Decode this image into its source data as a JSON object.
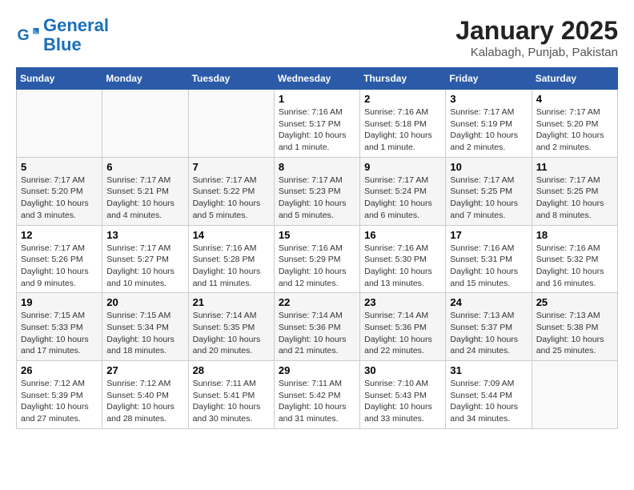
{
  "header": {
    "logo_line1": "General",
    "logo_line2": "Blue",
    "month": "January 2025",
    "location": "Kalabagh, Punjab, Pakistan"
  },
  "days_of_week": [
    "Sunday",
    "Monday",
    "Tuesday",
    "Wednesday",
    "Thursday",
    "Friday",
    "Saturday"
  ],
  "weeks": [
    [
      {
        "day": "",
        "info": ""
      },
      {
        "day": "",
        "info": ""
      },
      {
        "day": "",
        "info": ""
      },
      {
        "day": "1",
        "info": "Sunrise: 7:16 AM\nSunset: 5:17 PM\nDaylight: 10 hours\nand 1 minute."
      },
      {
        "day": "2",
        "info": "Sunrise: 7:16 AM\nSunset: 5:18 PM\nDaylight: 10 hours\nand 1 minute."
      },
      {
        "day": "3",
        "info": "Sunrise: 7:17 AM\nSunset: 5:19 PM\nDaylight: 10 hours\nand 2 minutes."
      },
      {
        "day": "4",
        "info": "Sunrise: 7:17 AM\nSunset: 5:20 PM\nDaylight: 10 hours\nand 2 minutes."
      }
    ],
    [
      {
        "day": "5",
        "info": "Sunrise: 7:17 AM\nSunset: 5:20 PM\nDaylight: 10 hours\nand 3 minutes."
      },
      {
        "day": "6",
        "info": "Sunrise: 7:17 AM\nSunset: 5:21 PM\nDaylight: 10 hours\nand 4 minutes."
      },
      {
        "day": "7",
        "info": "Sunrise: 7:17 AM\nSunset: 5:22 PM\nDaylight: 10 hours\nand 5 minutes."
      },
      {
        "day": "8",
        "info": "Sunrise: 7:17 AM\nSunset: 5:23 PM\nDaylight: 10 hours\nand 5 minutes."
      },
      {
        "day": "9",
        "info": "Sunrise: 7:17 AM\nSunset: 5:24 PM\nDaylight: 10 hours\nand 6 minutes."
      },
      {
        "day": "10",
        "info": "Sunrise: 7:17 AM\nSunset: 5:25 PM\nDaylight: 10 hours\nand 7 minutes."
      },
      {
        "day": "11",
        "info": "Sunrise: 7:17 AM\nSunset: 5:25 PM\nDaylight: 10 hours\nand 8 minutes."
      }
    ],
    [
      {
        "day": "12",
        "info": "Sunrise: 7:17 AM\nSunset: 5:26 PM\nDaylight: 10 hours\nand 9 minutes."
      },
      {
        "day": "13",
        "info": "Sunrise: 7:17 AM\nSunset: 5:27 PM\nDaylight: 10 hours\nand 10 minutes."
      },
      {
        "day": "14",
        "info": "Sunrise: 7:16 AM\nSunset: 5:28 PM\nDaylight: 10 hours\nand 11 minutes."
      },
      {
        "day": "15",
        "info": "Sunrise: 7:16 AM\nSunset: 5:29 PM\nDaylight: 10 hours\nand 12 minutes."
      },
      {
        "day": "16",
        "info": "Sunrise: 7:16 AM\nSunset: 5:30 PM\nDaylight: 10 hours\nand 13 minutes."
      },
      {
        "day": "17",
        "info": "Sunrise: 7:16 AM\nSunset: 5:31 PM\nDaylight: 10 hours\nand 15 minutes."
      },
      {
        "day": "18",
        "info": "Sunrise: 7:16 AM\nSunset: 5:32 PM\nDaylight: 10 hours\nand 16 minutes."
      }
    ],
    [
      {
        "day": "19",
        "info": "Sunrise: 7:15 AM\nSunset: 5:33 PM\nDaylight: 10 hours\nand 17 minutes."
      },
      {
        "day": "20",
        "info": "Sunrise: 7:15 AM\nSunset: 5:34 PM\nDaylight: 10 hours\nand 18 minutes."
      },
      {
        "day": "21",
        "info": "Sunrise: 7:14 AM\nSunset: 5:35 PM\nDaylight: 10 hours\nand 20 minutes."
      },
      {
        "day": "22",
        "info": "Sunrise: 7:14 AM\nSunset: 5:36 PM\nDaylight: 10 hours\nand 21 minutes."
      },
      {
        "day": "23",
        "info": "Sunrise: 7:14 AM\nSunset: 5:36 PM\nDaylight: 10 hours\nand 22 minutes."
      },
      {
        "day": "24",
        "info": "Sunrise: 7:13 AM\nSunset: 5:37 PM\nDaylight: 10 hours\nand 24 minutes."
      },
      {
        "day": "25",
        "info": "Sunrise: 7:13 AM\nSunset: 5:38 PM\nDaylight: 10 hours\nand 25 minutes."
      }
    ],
    [
      {
        "day": "26",
        "info": "Sunrise: 7:12 AM\nSunset: 5:39 PM\nDaylight: 10 hours\nand 27 minutes."
      },
      {
        "day": "27",
        "info": "Sunrise: 7:12 AM\nSunset: 5:40 PM\nDaylight: 10 hours\nand 28 minutes."
      },
      {
        "day": "28",
        "info": "Sunrise: 7:11 AM\nSunset: 5:41 PM\nDaylight: 10 hours\nand 30 minutes."
      },
      {
        "day": "29",
        "info": "Sunrise: 7:11 AM\nSunset: 5:42 PM\nDaylight: 10 hours\nand 31 minutes."
      },
      {
        "day": "30",
        "info": "Sunrise: 7:10 AM\nSunset: 5:43 PM\nDaylight: 10 hours\nand 33 minutes."
      },
      {
        "day": "31",
        "info": "Sunrise: 7:09 AM\nSunset: 5:44 PM\nDaylight: 10 hours\nand 34 minutes."
      },
      {
        "day": "",
        "info": ""
      }
    ]
  ]
}
